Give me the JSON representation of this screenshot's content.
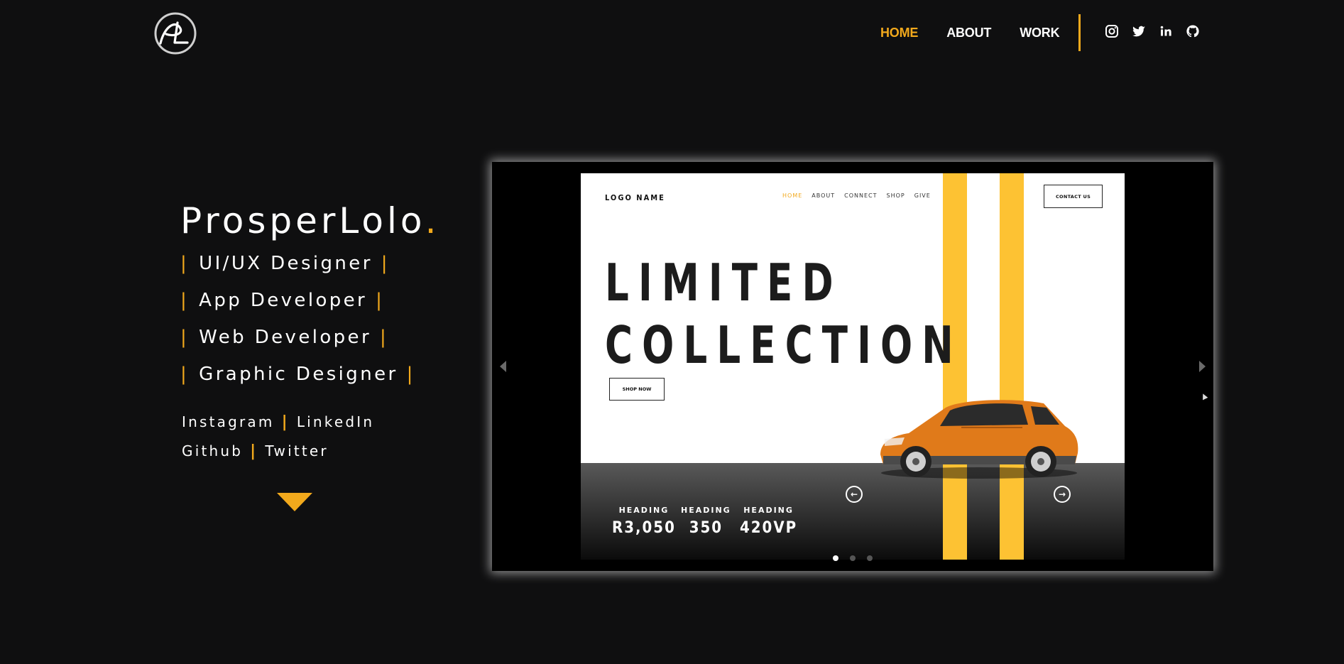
{
  "header": {
    "logo_text": "PL",
    "nav": [
      {
        "label": "HOME",
        "active": true
      },
      {
        "label": "ABOUT",
        "active": false
      },
      {
        "label": "WORK",
        "active": false
      }
    ],
    "socials": [
      "instagram-icon",
      "twitter-icon",
      "linkedin-icon",
      "github-icon"
    ]
  },
  "hero": {
    "name": "ProsperLolo",
    "name_dot": ".",
    "roles": [
      "UI/UX Designer",
      "App Developer",
      "Web Developer",
      "Graphic Designer"
    ],
    "links": {
      "row1": [
        "Instagram",
        "LinkedIn"
      ],
      "row2": [
        "Github",
        "Twitter"
      ]
    },
    "separator": "|"
  },
  "slider": {
    "active_index": 0,
    "slide_count": 3,
    "slide": {
      "logo": "LOGO NAME",
      "nav": [
        "HOME",
        "ABOUT",
        "CONNECT",
        "SHOP",
        "GIVE"
      ],
      "contact": "CONTACT US",
      "title_line1": "LIMITED",
      "title_line2": "COLLECTION",
      "shop_button": "SHOP NOW",
      "stats": [
        {
          "heading": "HEADING",
          "value": "R3,050"
        },
        {
          "heading": "HEADING",
          "value": "350"
        },
        {
          "heading": "HEADING",
          "value": "420VP"
        }
      ]
    }
  },
  "colors": {
    "accent": "#f2a91c",
    "stripe": "#fdc233",
    "background": "#0f0f10"
  }
}
